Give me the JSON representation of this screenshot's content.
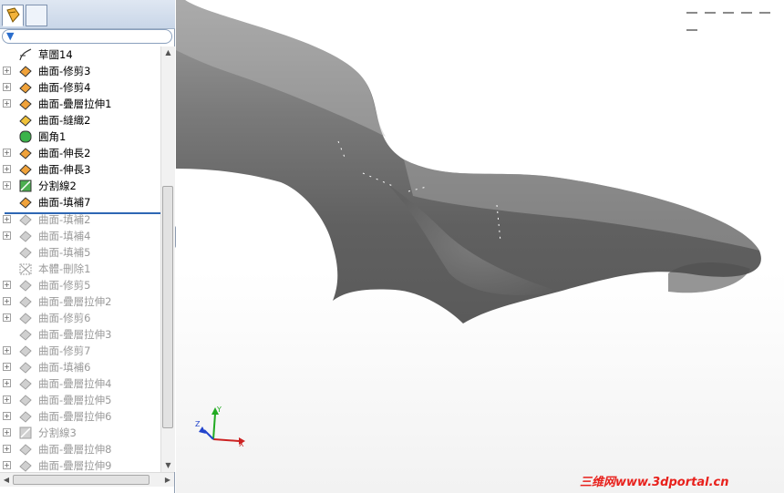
{
  "panel": {
    "filter_icon": "filter-funnel-icon",
    "tree": [
      {
        "label": "草圖14",
        "icon": "sketch-icon",
        "expandable": false,
        "active": true
      },
      {
        "label": "曲面-修剪3",
        "icon": "surface-trim-icon",
        "expandable": true,
        "active": true
      },
      {
        "label": "曲面-修剪4",
        "icon": "surface-trim-icon",
        "expandable": true,
        "active": true
      },
      {
        "label": "曲面-疊層拉伸1",
        "icon": "surface-loft-icon",
        "expandable": true,
        "active": true
      },
      {
        "label": "曲面-縫織2",
        "icon": "surface-knit-icon",
        "expandable": false,
        "active": true
      },
      {
        "label": "圓角1",
        "icon": "fillet-icon",
        "expandable": false,
        "active": true
      },
      {
        "label": "曲面-伸長2",
        "icon": "surface-extend-icon",
        "expandable": true,
        "active": true
      },
      {
        "label": "曲面-伸長3",
        "icon": "surface-extend-icon",
        "expandable": true,
        "active": true
      },
      {
        "label": "分割線2",
        "icon": "split-line-icon",
        "expandable": true,
        "active": true
      },
      {
        "label": "曲面-填補7",
        "icon": "surface-fill-icon",
        "expandable": false,
        "active": true
      },
      {
        "label": "曲面-填補2",
        "icon": "surface-fill-icon",
        "expandable": true,
        "active": false
      },
      {
        "label": "曲面-填補4",
        "icon": "surface-fill-icon",
        "expandable": true,
        "active": false
      },
      {
        "label": "曲面-填補5",
        "icon": "surface-fill-icon",
        "expandable": false,
        "active": false
      },
      {
        "label": "本體-刪除1",
        "icon": "body-delete-icon",
        "expandable": false,
        "active": false
      },
      {
        "label": "曲面-修剪5",
        "icon": "surface-trim-icon",
        "expandable": true,
        "active": false
      },
      {
        "label": "曲面-疊層拉伸2",
        "icon": "surface-loft-icon",
        "expandable": true,
        "active": false
      },
      {
        "label": "曲面-修剪6",
        "icon": "surface-trim-icon",
        "expandable": true,
        "active": false
      },
      {
        "label": "曲面-疊層拉伸3",
        "icon": "surface-loft-icon",
        "expandable": false,
        "active": false
      },
      {
        "label": "曲面-修剪7",
        "icon": "surface-trim-icon",
        "expandable": true,
        "active": false
      },
      {
        "label": "曲面-填補6",
        "icon": "surface-fill-icon",
        "expandable": true,
        "active": false
      },
      {
        "label": "曲面-疊層拉伸4",
        "icon": "surface-loft-icon",
        "expandable": true,
        "active": false
      },
      {
        "label": "曲面-疊層拉伸5",
        "icon": "surface-loft-icon",
        "expandable": true,
        "active": false
      },
      {
        "label": "曲面-疊層拉伸6",
        "icon": "surface-loft-icon",
        "expandable": true,
        "active": false
      },
      {
        "label": "分割線3",
        "icon": "split-line-icon",
        "expandable": true,
        "active": false
      },
      {
        "label": "曲面-疊層拉伸8",
        "icon": "surface-loft-icon",
        "expandable": true,
        "active": false
      },
      {
        "label": "曲面-疊層拉伸9",
        "icon": "surface-loft-icon",
        "expandable": true,
        "active": false
      }
    ]
  },
  "viewport": {
    "triad": {
      "x": "X",
      "y": "Y",
      "z": "Z"
    }
  },
  "watermark": "三维网www.3dportal.cn",
  "colors": {
    "active_text": "#000000",
    "suppressed_text": "#9a9a9a",
    "rollback_bar": "#2e67b4",
    "watermark": "#e8211c",
    "model_surface": "#7a7a7a"
  }
}
